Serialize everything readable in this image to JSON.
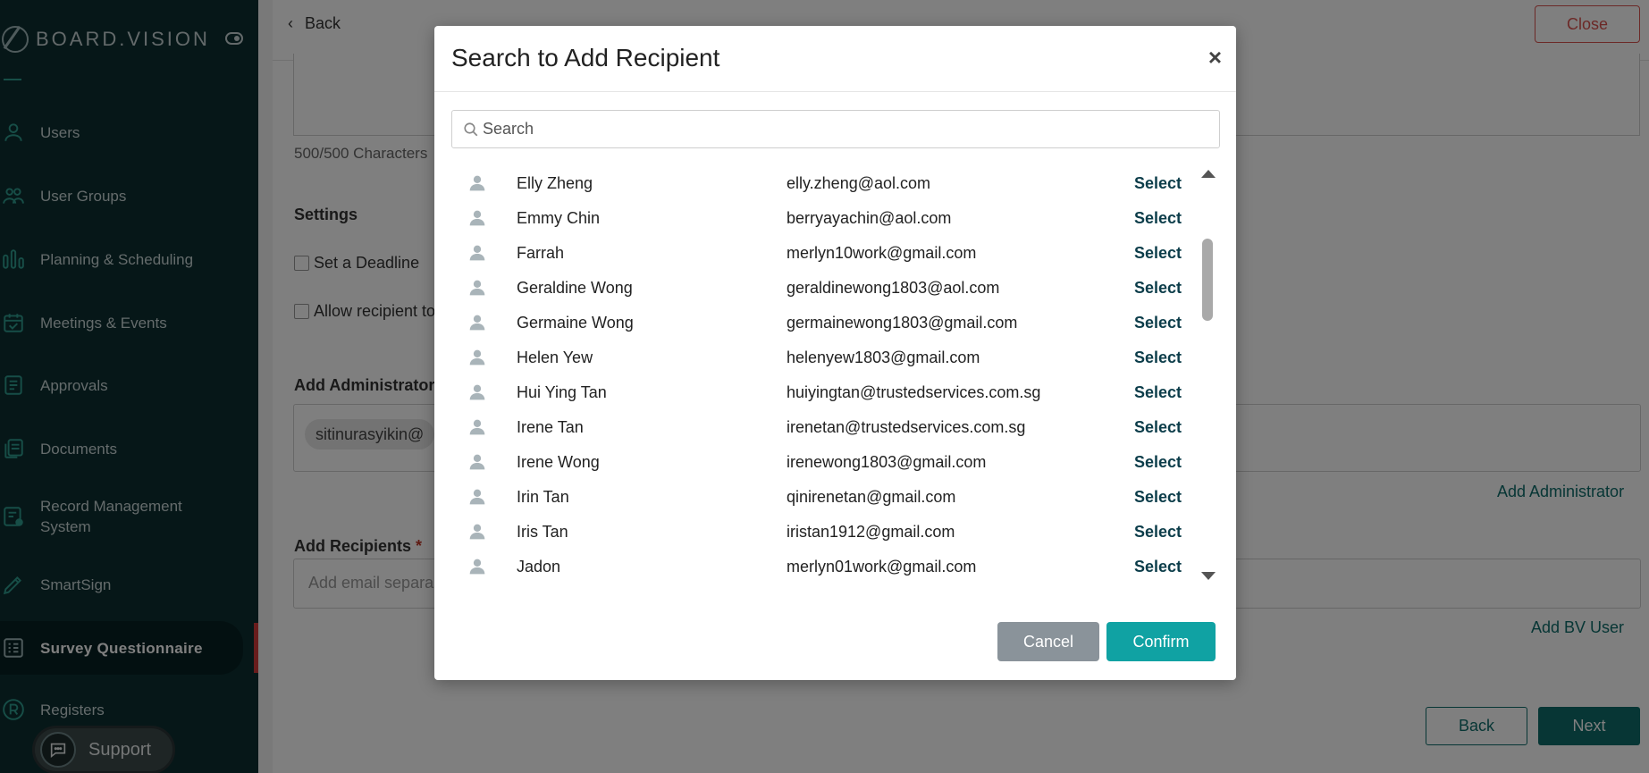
{
  "app": {
    "brand": "BOARD.VISION"
  },
  "sidebar": {
    "items": [
      {
        "label": "Users",
        "icon": "user-icon"
      },
      {
        "label": "User Groups",
        "icon": "user-group-icon"
      },
      {
        "label": "Planning & Scheduling",
        "icon": "bar-chart-icon"
      },
      {
        "label": "Meetings & Events",
        "icon": "calendar-check-icon"
      },
      {
        "label": "Approvals",
        "icon": "document-lines-icon"
      },
      {
        "label": "Documents",
        "icon": "documents-icon"
      },
      {
        "label": "Record Management System",
        "icon": "record-system-icon"
      },
      {
        "label": "SmartSign",
        "icon": "pen-icon"
      },
      {
        "label": "Survey Questionnaire",
        "icon": "survey-icon",
        "active": true
      },
      {
        "label": "Registers",
        "icon": "registered-icon"
      }
    ],
    "support_label": "Support"
  },
  "page": {
    "back_label": "Back",
    "close_label": "Close",
    "char_count": "500/500 Characters",
    "settings_title": "Settings",
    "deadline_label": "Set a Deadline",
    "allow_label": "Allow recipient to",
    "admin_title": "Add Administrator",
    "admin_chip": "sitinurasyikin@",
    "add_admin_link": "Add Administrator",
    "recipients_title": "Add Recipients",
    "recipients_required": "*",
    "recipients_placeholder": "Add email separa",
    "add_bv_user_link": "Add BV User",
    "footer_back": "Back",
    "footer_next": "Next"
  },
  "modal": {
    "title": "Search to Add Recipient",
    "close_symbol": "×",
    "search_placeholder": "Search",
    "select_label": "Select",
    "cancel_label": "Cancel",
    "confirm_label": "Confirm",
    "rows": [
      {
        "name": "Elly Zheng",
        "email": "elly.zheng@aol.com"
      },
      {
        "name": "Emmy Chin",
        "email": "berryayachin@aol.com"
      },
      {
        "name": "Farrah",
        "email": "merlyn10work@gmail.com"
      },
      {
        "name": "Geraldine Wong",
        "email": "geraldinewong1803@aol.com"
      },
      {
        "name": "Germaine Wong",
        "email": "germainewong1803@gmail.com"
      },
      {
        "name": "Helen Yew",
        "email": "helenyew1803@gmail.com"
      },
      {
        "name": "Hui Ying Tan",
        "email": "huiyingtan@trustedservices.com.sg"
      },
      {
        "name": "Irene Tan",
        "email": "irenetan@trustedservices.com.sg"
      },
      {
        "name": "Irene Wong",
        "email": "irenewong1803@gmail.com"
      },
      {
        "name": "Irin Tan",
        "email": "qinirenetan@gmail.com"
      },
      {
        "name": "Iris Tan",
        "email": "iristan1912@gmail.com"
      },
      {
        "name": "Jadon",
        "email": "merlyn01work@gmail.com"
      }
    ]
  },
  "colors": {
    "sidebar_bg": "#0c2e30",
    "accent_teal": "#0f6d6a",
    "confirm_teal": "#10a2a3",
    "cancel_gray": "#8a939a",
    "close_red": "#d9534f"
  }
}
